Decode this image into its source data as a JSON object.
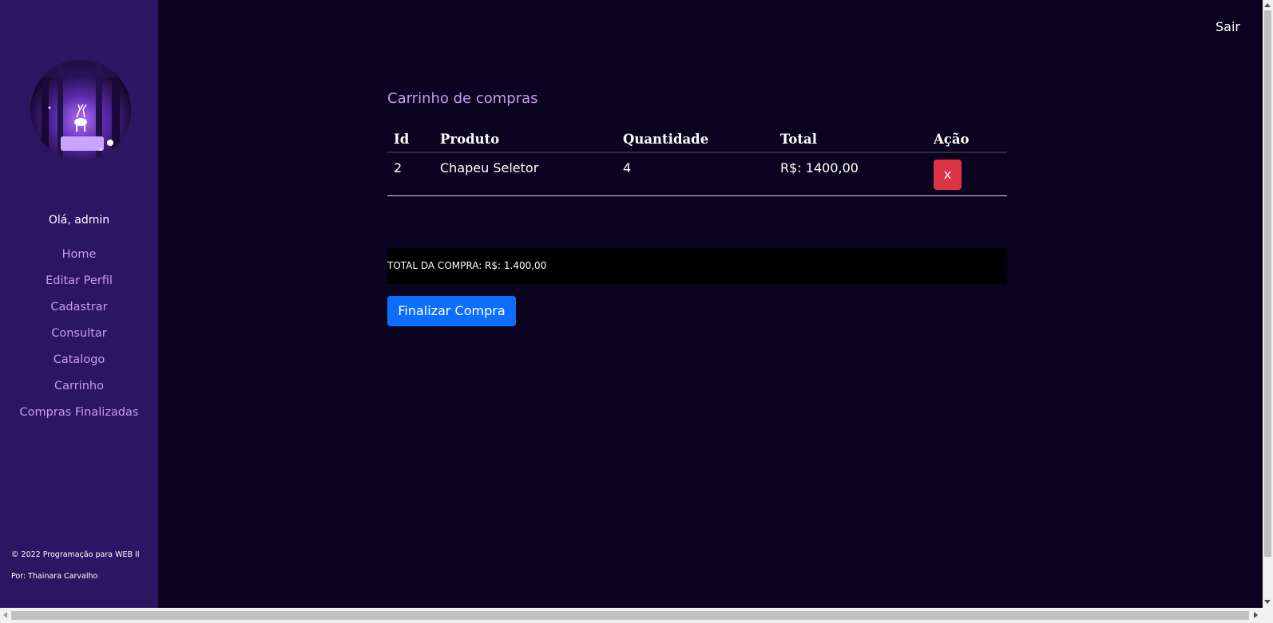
{
  "sidebar": {
    "greeting": "Olá, admin",
    "items": [
      {
        "label": "Home"
      },
      {
        "label": "Editar Perfil"
      },
      {
        "label": "Cadastrar"
      },
      {
        "label": "Consultar"
      },
      {
        "label": "Catalogo"
      },
      {
        "label": "Carrinho"
      },
      {
        "label": "Compras Finalizadas"
      }
    ],
    "footer": {
      "copyright": "© 2022 Programação para WEB II",
      "author": "Por: Thainara Carvalho"
    }
  },
  "header": {
    "logout_label": "Sair"
  },
  "cart": {
    "title": "Carrinho de compras",
    "columns": [
      "Id",
      "Produto",
      "Quantidade",
      "Total",
      "Ação"
    ],
    "rows": [
      {
        "id": "2",
        "product": "Chapeu Seletor",
        "quantity": "4",
        "total": "R$: 1400,00",
        "action_label": "x"
      }
    ],
    "grand_total": "TOTAL DA COMPRA: R$: 1.400,00",
    "checkout_label": "Finalizar Compra"
  },
  "colors": {
    "sidebar_bg": "#2c1664",
    "page_bg": "#0b0420",
    "link": "#c49bf0",
    "danger": "#dc3545",
    "primary": "#0d6efd"
  }
}
